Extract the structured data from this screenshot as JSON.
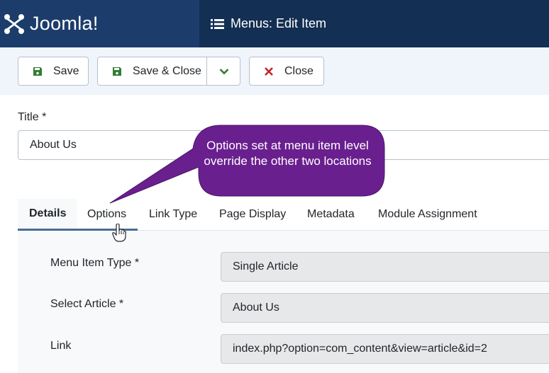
{
  "header": {
    "brand": "Joomla!",
    "page_title": "Menus: Edit Item",
    "colors": {
      "brand_bg": "#1c3d6b",
      "bar_bg": "#132f53"
    }
  },
  "toolbar": {
    "save_label": "Save",
    "save_close_label": "Save & Close",
    "close_label": "Close",
    "save_icon": "floppy-disk-icon",
    "close_icon": "x-icon",
    "dropdown_icon": "chevron-down-icon",
    "colors": {
      "save_icon": "#2f7d32",
      "close_icon": "#c52827"
    }
  },
  "title_field": {
    "label": "Title *",
    "value": "About Us"
  },
  "callout": {
    "text": "Options set at menu item level override the other two locations",
    "color": "#6a1f8f"
  },
  "tabs": [
    {
      "label": "Details",
      "active": true
    },
    {
      "label": "Options"
    },
    {
      "label": "Link Type"
    },
    {
      "label": "Page Display"
    },
    {
      "label": "Metadata"
    },
    {
      "label": "Module Assignment"
    }
  ],
  "fields": [
    {
      "label": "Menu Item Type *",
      "value": "Single Article"
    },
    {
      "label": "Select Article *",
      "value": "About Us"
    },
    {
      "label": "Link",
      "value": "index.php?option=com_content&view=article&id=2"
    }
  ]
}
